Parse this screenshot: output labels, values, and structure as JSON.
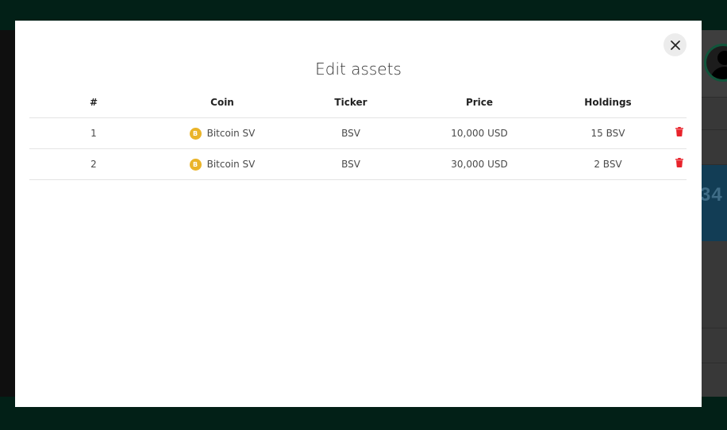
{
  "modal": {
    "title": "Edit assets",
    "close_icon": "close-icon"
  },
  "table": {
    "columns": [
      "#",
      "Coin",
      "Ticker",
      "Price",
      "Holdings"
    ],
    "rows": [
      {
        "index": "1",
        "coin": "Bitcoin SV",
        "coin_icon": "B",
        "ticker": "BSV",
        "price": "10,000 USD",
        "holdings": "15 BSV",
        "action_icon": "trash-icon"
      },
      {
        "index": "2",
        "coin": "Bitcoin SV",
        "coin_icon": "B",
        "ticker": "BSV",
        "price": "30,000 USD",
        "holdings": "2 BSV",
        "action_icon": "trash-icon"
      }
    ]
  },
  "background": {
    "partial_value": "34"
  },
  "colors": {
    "brand_dark_green": "#022017",
    "coin_gold": "#eab429",
    "delete_red": "#e8232b",
    "panel_blue": "#123d55"
  }
}
